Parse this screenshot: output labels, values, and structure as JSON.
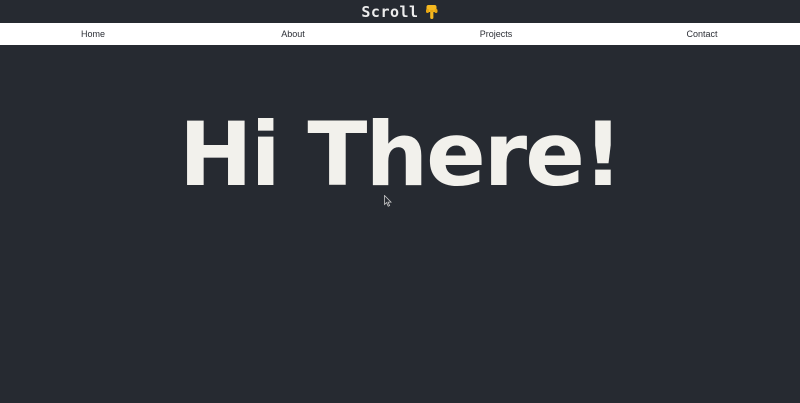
{
  "header": {
    "title": "Scroll",
    "icon": "pointing-down-hand-icon",
    "icon_color": "#f5b820"
  },
  "nav": {
    "items": [
      {
        "label": "Home"
      },
      {
        "label": "About"
      },
      {
        "label": "Projects"
      },
      {
        "label": "Contact"
      }
    ]
  },
  "hero": {
    "heading": "Hi There!"
  },
  "colors": {
    "background": "#262a31",
    "navbar": "#ffffff",
    "heading": "#f2f1ec"
  }
}
